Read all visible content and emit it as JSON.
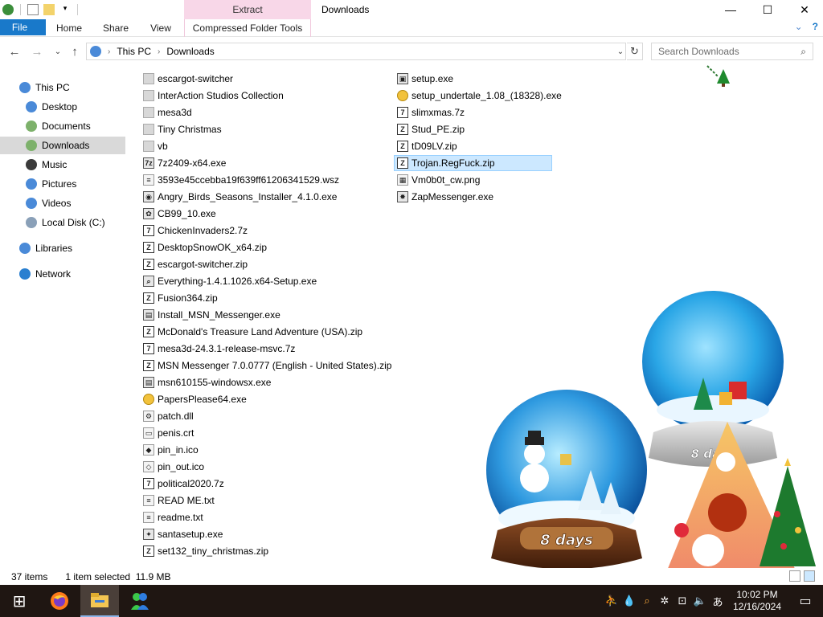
{
  "window": {
    "title": "Downloads",
    "context_tab": "Extract",
    "controls": {
      "minimize": "—",
      "maximize": "☐",
      "close": "✕"
    }
  },
  "ribbon": {
    "tabs": [
      {
        "label": "File"
      },
      {
        "label": "Home"
      },
      {
        "label": "Share"
      },
      {
        "label": "View"
      },
      {
        "label": "Compressed Folder Tools"
      }
    ],
    "collapse_glyph": "⌄",
    "help_glyph": "?"
  },
  "address": {
    "crumbs": [
      "This PC",
      "Downloads"
    ],
    "back": "←",
    "forward": "→",
    "recent": "⌄",
    "up": "↑",
    "dropdown": "⌄",
    "refresh": "↻"
  },
  "search": {
    "placeholder": "Search Downloads"
  },
  "nav_pane": [
    {
      "label": "This PC",
      "icon": "pc-icon",
      "color": "#4a8ad8"
    },
    {
      "label": "Desktop",
      "icon": "desktop-icon",
      "color": "#4a8ad8"
    },
    {
      "label": "Documents",
      "icon": "documents-icon",
      "color": "#7db16b"
    },
    {
      "label": "Downloads",
      "icon": "downloads-icon",
      "color": "#7db16b",
      "selected": true
    },
    {
      "label": "Music",
      "icon": "music-icon",
      "color": "#3a3a3a"
    },
    {
      "label": "Pictures",
      "icon": "pictures-icon",
      "color": "#4a8ad8"
    },
    {
      "label": "Videos",
      "icon": "videos-icon",
      "color": "#4a8ad8"
    },
    {
      "label": "Local Disk (C:)",
      "icon": "disk-icon",
      "color": "#8aa0b8"
    },
    {
      "label": "Libraries",
      "icon": "libraries-icon",
      "color": "#4a8ad8"
    },
    {
      "label": "Network",
      "icon": "network-icon",
      "color": "#2a7fd0"
    }
  ],
  "files": [
    {
      "name": "escargot-switcher",
      "kind": "folder"
    },
    {
      "name": "InterAction Studios Collection",
      "kind": "folder"
    },
    {
      "name": "mesa3d",
      "kind": "folder"
    },
    {
      "name": "Tiny Christmas",
      "kind": "folder"
    },
    {
      "name": "vb",
      "kind": "folder"
    },
    {
      "name": "7z2409-x64.exe",
      "kind": "exe",
      "glyph": "7z"
    },
    {
      "name": "3593e45ccebba19f639ff61206341529.wsz",
      "kind": "txt",
      "glyph": "≡"
    },
    {
      "name": "Angry_Birds_Seasons_Installer_4.1.0.exe",
      "kind": "exe",
      "glyph": "◉"
    },
    {
      "name": "CB99_10.exe",
      "kind": "exe",
      "glyph": "✿"
    },
    {
      "name": "ChickenInvaders2.7z",
      "kind": "zip",
      "glyph": "7"
    },
    {
      "name": "DesktopSnowOK_x64.zip",
      "kind": "zip",
      "glyph": "Z"
    },
    {
      "name": "escargot-switcher.zip",
      "kind": "zip",
      "glyph": "Z"
    },
    {
      "name": "Everything-1.4.1.1026.x64-Setup.exe",
      "kind": "exe",
      "glyph": "⌕"
    },
    {
      "name": "Fusion364.zip",
      "kind": "zip",
      "glyph": "Z"
    },
    {
      "name": "Install_MSN_Messenger.exe",
      "kind": "exe",
      "glyph": "▤"
    },
    {
      "name": "McDonald's Treasure Land Adventure (USA).zip",
      "kind": "zip",
      "glyph": "Z"
    },
    {
      "name": "mesa3d-24.3.1-release-msvc.7z",
      "kind": "zip",
      "glyph": "7"
    },
    {
      "name": "MSN Messenger 7.0.0777 (English - United States).zip",
      "kind": "zip",
      "glyph": "Z"
    },
    {
      "name": "msn610155-windowsx.exe",
      "kind": "exe",
      "glyph": "▤"
    },
    {
      "name": "PapersPlease64.exe",
      "kind": "gold",
      "glyph": ""
    },
    {
      "name": "patch.dll",
      "kind": "txt",
      "glyph": "⚙"
    },
    {
      "name": "penis.crt",
      "kind": "txt",
      "glyph": "▭"
    },
    {
      "name": "pin_in.ico",
      "kind": "txt",
      "glyph": "◆"
    },
    {
      "name": "pin_out.ico",
      "kind": "txt",
      "glyph": "◇"
    },
    {
      "name": "political2020.7z",
      "kind": "zip",
      "glyph": "7"
    },
    {
      "name": "READ ME.txt",
      "kind": "txt",
      "glyph": "≡"
    },
    {
      "name": "readme.txt",
      "kind": "txt",
      "glyph": "≡"
    },
    {
      "name": "santasetup.exe",
      "kind": "exe",
      "glyph": "✦"
    },
    {
      "name": "set132_tiny_christmas.zip",
      "kind": "zip",
      "glyph": "Z"
    },
    {
      "name": "setup.exe",
      "kind": "exe",
      "glyph": "▣"
    },
    {
      "name": "setup_undertale_1.08_(18328).exe",
      "kind": "gold",
      "glyph": ""
    },
    {
      "name": "slimxmas.7z",
      "kind": "zip",
      "glyph": "7"
    },
    {
      "name": "Stud_PE.zip",
      "kind": "zip",
      "glyph": "Z"
    },
    {
      "name": "tD09LV.zip",
      "kind": "zip",
      "glyph": "Z"
    },
    {
      "name": "Trojan.RegFuck.zip",
      "kind": "zip",
      "glyph": "Z",
      "selected": true
    },
    {
      "name": "Vm0b0t_cw.png",
      "kind": "txt",
      "glyph": "▦"
    },
    {
      "name": "ZapMessenger.exe",
      "kind": "exe",
      "glyph": "✸"
    }
  ],
  "status": {
    "items_count": "37 items",
    "selection": "1 item selected  11.9 MB"
  },
  "taskbar": {
    "apps": [
      {
        "name": "start-button",
        "glyph": "⊞"
      },
      {
        "name": "firefox-icon"
      },
      {
        "name": "file-explorer-icon",
        "active": true
      },
      {
        "name": "messenger-icon"
      }
    ],
    "tray_glyphs": [
      "⛹",
      "💧",
      "⌕",
      "✲",
      "⊡",
      "🔈",
      "あ"
    ],
    "clock_time": "10:02 PM",
    "clock_date": "12/16/2024",
    "notification_glyph": "▭"
  },
  "desktop": {
    "snowglobe_left_label": "8 days",
    "snowglobe_right_label": "8 days"
  },
  "colors": {
    "file_tab": "#1979ca",
    "context_tab": "#f8d7e8",
    "selection": "#cce8ff",
    "taskbar": "#1f1612"
  }
}
